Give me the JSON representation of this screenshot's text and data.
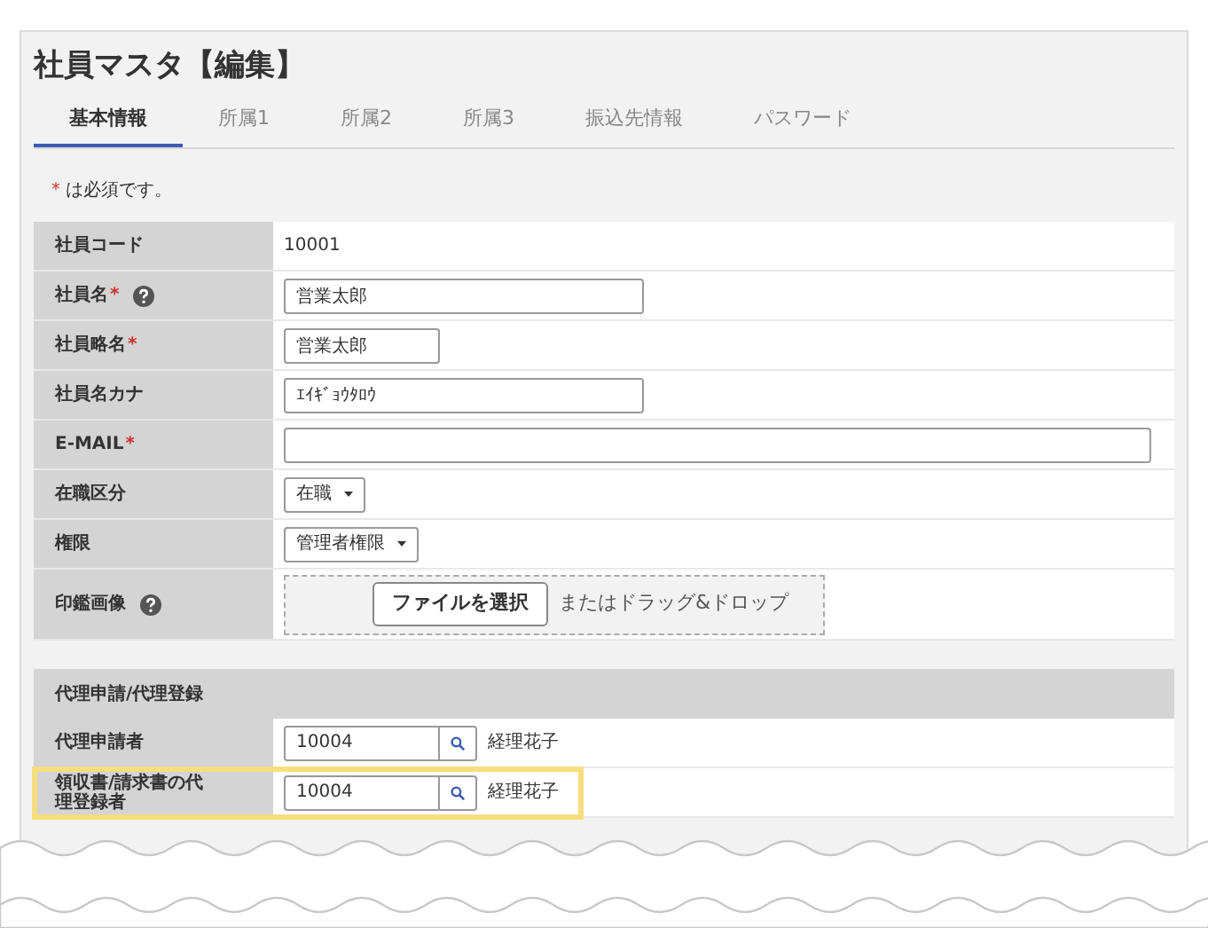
{
  "title": "社員マスタ【編集】",
  "tabs": [
    {
      "label": "基本情報",
      "selected": true
    },
    {
      "label": "所属1",
      "selected": false
    },
    {
      "label": "所属2",
      "selected": false
    },
    {
      "label": "所属3",
      "selected": false
    },
    {
      "label": "振込先情報",
      "selected": false
    },
    {
      "label": "パスワード",
      "selected": false
    }
  ],
  "required_note": {
    "mark": "*",
    "text": "は必須です。"
  },
  "rows": [
    {
      "label": "社員コード",
      "required": false,
      "help": false,
      "kind": "static",
      "value": "10001"
    },
    {
      "label": "社員名",
      "required": true,
      "help": true,
      "kind": "text_wide",
      "value": "営業太郎"
    },
    {
      "label": "社員略名",
      "required": true,
      "help": false,
      "kind": "text_narrow",
      "value": "営業太郎"
    },
    {
      "label": "社員名カナ",
      "required": false,
      "help": false,
      "kind": "text_wide",
      "value": "ｴｲｷﾞｮｳﾀﾛｳ"
    },
    {
      "label": "E-MAIL",
      "required": true,
      "help": false,
      "kind": "text_full",
      "value": ""
    },
    {
      "label": "在職区分",
      "required": false,
      "help": false,
      "kind": "select",
      "value": "在職"
    },
    {
      "label": "権限",
      "required": false,
      "help": false,
      "kind": "select",
      "value": "管理者権限"
    },
    {
      "label": "印鑑画像",
      "required": false,
      "help": true,
      "kind": "file",
      "button": "ファイルを選択",
      "hint": "またはドラッグ&ドロップ"
    }
  ],
  "proxy_section": {
    "heading": "代理申請/代理登録",
    "rows": [
      {
        "label": "代理申請者",
        "value": "10004",
        "name": "経理花子",
        "highlighted": false
      },
      {
        "label": "領収書/請求書の代理登録者",
        "value": "10004",
        "name": "経理花子",
        "highlighted": true
      }
    ]
  }
}
